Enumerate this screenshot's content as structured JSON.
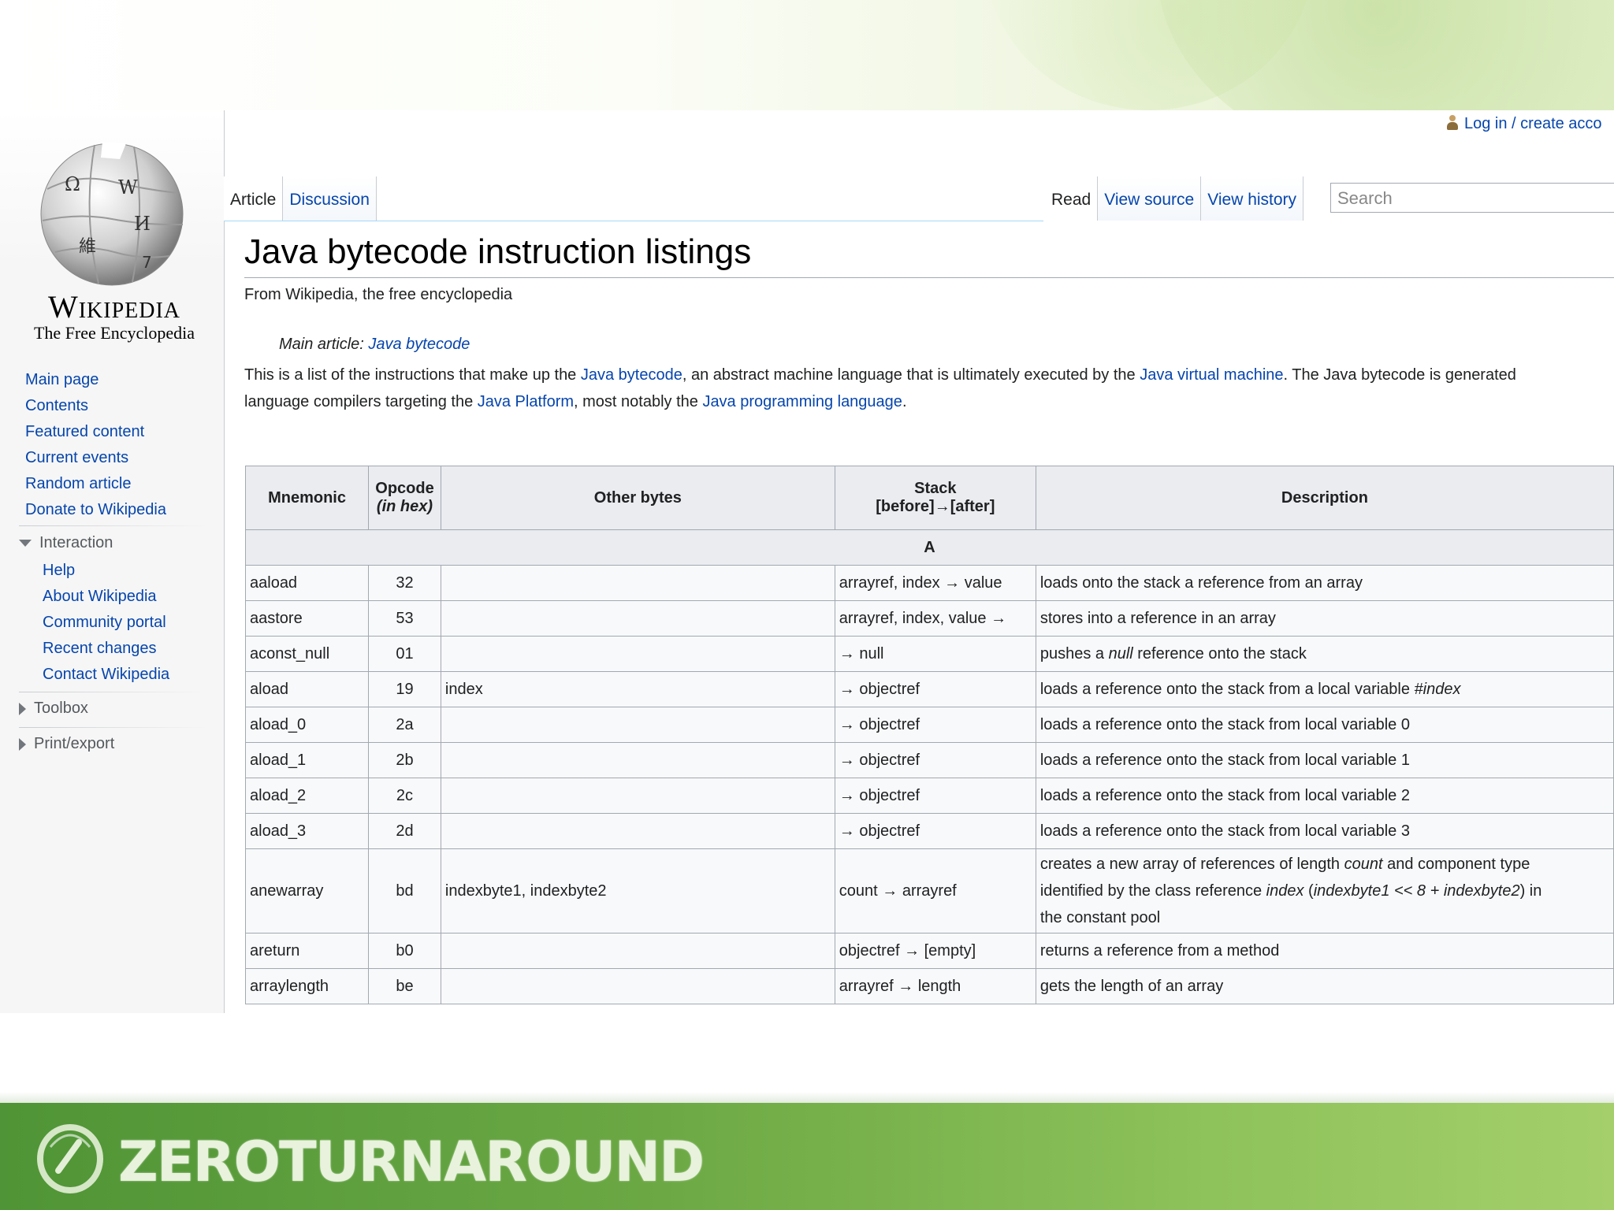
{
  "user": {
    "login_label": "Log in / create acco"
  },
  "logo": {
    "wordmark": "Wikipedia",
    "tagline": "The Free Encyclopedia"
  },
  "tabs": {
    "article": "Article",
    "discussion": "Discussion",
    "read": "Read",
    "view_source": "View source",
    "view_history": "View history"
  },
  "search": {
    "placeholder": "Search"
  },
  "nav": {
    "main": [
      "Main page",
      "Contents",
      "Featured content",
      "Current events",
      "Random article",
      "Donate to Wikipedia"
    ],
    "interaction_heading": "Interaction",
    "interaction": [
      "Help",
      "About Wikipedia",
      "Community portal",
      "Recent changes",
      "Contact Wikipedia"
    ],
    "toolbox_heading": "Toolbox",
    "print_heading": "Print/export"
  },
  "article": {
    "title": "Java bytecode instruction listings",
    "from": "From Wikipedia, the free encyclopedia",
    "hatnote_prefix": "Main article: ",
    "hatnote_link": "Java bytecode",
    "intro": {
      "t1": "This is a list of the instructions that make up the ",
      "l1": "Java bytecode",
      "t2": ", an abstract machine language that is ultimately executed by the ",
      "l2": "Java virtual machine",
      "t3": ". The Java bytecode is generated",
      "t4": "language compilers targeting the ",
      "l3": "Java Platform",
      "t5": ", most notably the ",
      "l4": "Java programming language",
      "t6": "."
    }
  },
  "table": {
    "headers": {
      "mnemonic": "Mnemonic",
      "opcode": "Opcode",
      "opcode_sub": "(in hex)",
      "other": "Other bytes",
      "stack": "Stack",
      "stack_sub": "[before]→[after]",
      "description": "Description"
    },
    "section": "A",
    "rows": [
      {
        "m": "aaload",
        "o": "32",
        "b": "",
        "s": "arrayref, index → value",
        "d": "loads onto the stack a reference from an array"
      },
      {
        "m": "aastore",
        "o": "53",
        "b": "",
        "s": "arrayref, index, value →",
        "d": "stores into a reference in an array"
      },
      {
        "m": "aconst_null",
        "o": "01",
        "b": "",
        "s": "→ null",
        "d1": "pushes a ",
        "d2": "null",
        "d3": " reference onto the stack"
      },
      {
        "m": "aload",
        "o": "19",
        "b": "index",
        "s": "→ objectref",
        "d1": "loads a reference onto the stack from a local variable ",
        "d2": "#index"
      },
      {
        "m": "aload_0",
        "o": "2a",
        "b": "",
        "s": "→ objectref",
        "d": "loads a reference onto the stack from local variable 0"
      },
      {
        "m": "aload_1",
        "o": "2b",
        "b": "",
        "s": "→ objectref",
        "d": "loads a reference onto the stack from local variable 1"
      },
      {
        "m": "aload_2",
        "o": "2c",
        "b": "",
        "s": "→ objectref",
        "d": "loads a reference onto the stack from local variable 2"
      },
      {
        "m": "aload_3",
        "o": "2d",
        "b": "",
        "s": "→ objectref",
        "d": "loads a reference onto the stack from local variable 3"
      },
      {
        "m": "anewarray",
        "o": "bd",
        "b": "indexbyte1, indexbyte2",
        "s": "count → arrayref",
        "d1": "creates a new array of references of length ",
        "d2": "count",
        "d3": " and component type",
        "d4": "identified by the class reference ",
        "d5": "index",
        "d6": " (",
        "d7": "indexbyte1 << 8 + indexbyte2",
        "d8": ") in",
        "d9": "the constant pool"
      },
      {
        "m": "areturn",
        "o": "b0",
        "b": "",
        "s": "objectref → [empty]",
        "d": "returns a reference from a method"
      },
      {
        "m": "arraylength",
        "o": "be",
        "b": "",
        "s": "arrayref → length",
        "d": "gets the length of an array"
      }
    ]
  },
  "footer": {
    "brand": "ZEROTURNAROUND"
  },
  "colors": {
    "link": "#0645ad",
    "footer_green": "#6ba844"
  }
}
